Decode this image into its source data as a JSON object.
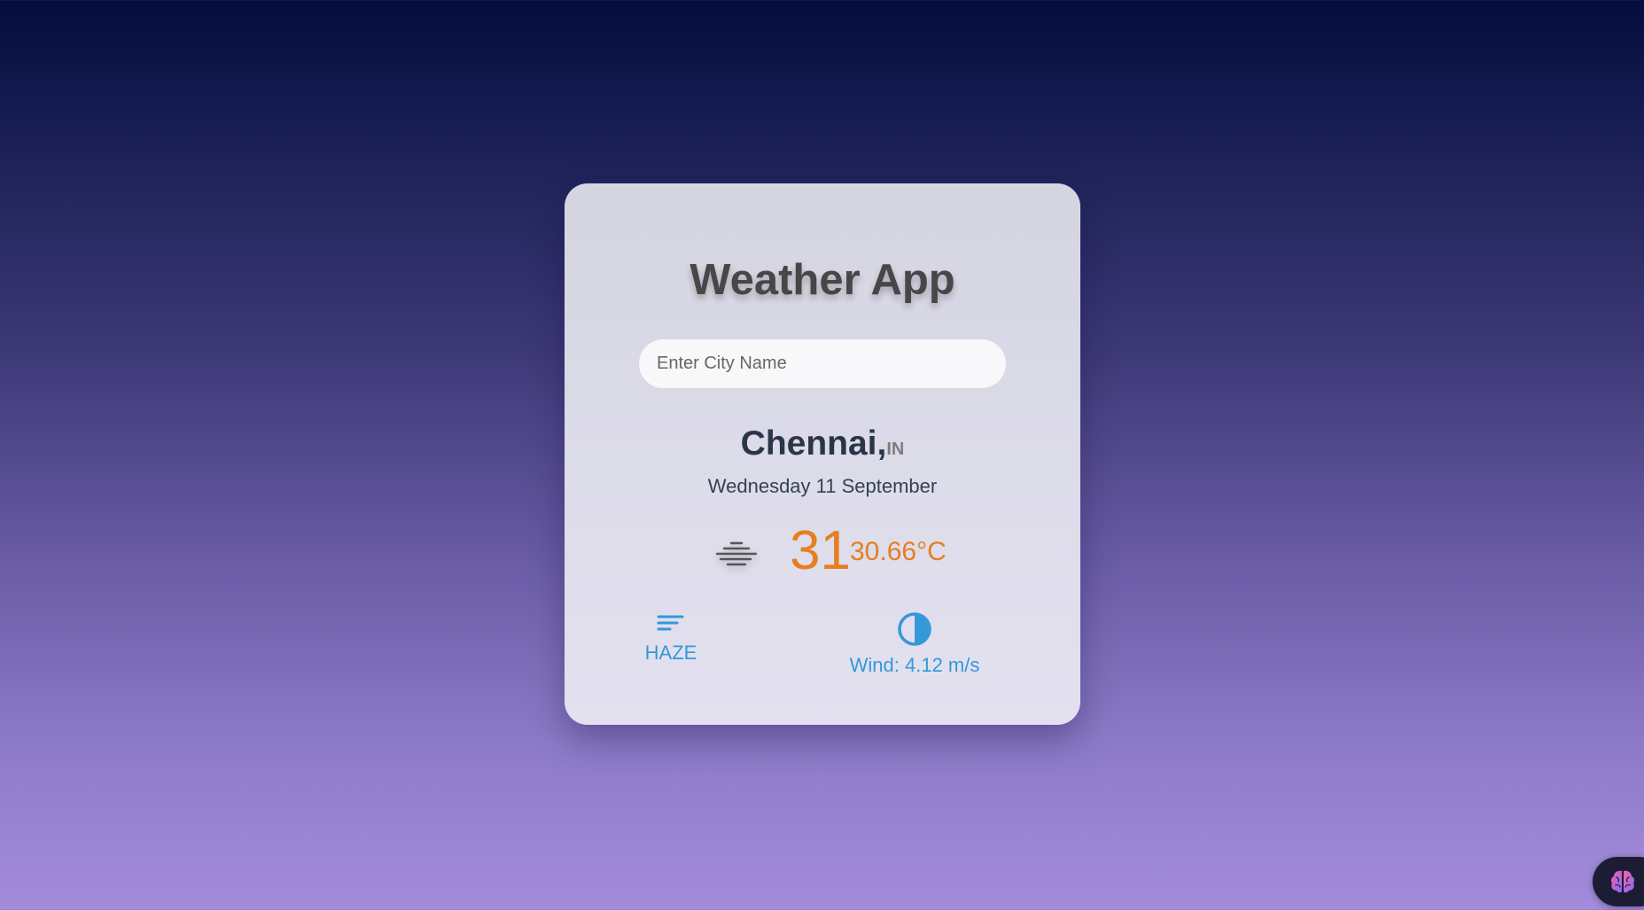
{
  "app": {
    "title": "Weather App"
  },
  "search": {
    "placeholder": "Enter City Name",
    "value": ""
  },
  "location": {
    "city": "Chennai,",
    "country": "IN",
    "date": "Wednesday 11 September"
  },
  "weather": {
    "icon": "haze-icon",
    "temperature_rounded": "31",
    "temperature_exact": "30.66°C",
    "condition": "HAZE",
    "condition_icon": "sort-lines-icon",
    "wind": "Wind: 4.12 m/s",
    "wind_icon": "half-circle-icon"
  },
  "assistant": {
    "icon": "brain-icon"
  },
  "colors": {
    "accent_orange": "#e67e22",
    "accent_blue": "#3498db",
    "title_text": "#474747",
    "city_text": "#2a3548"
  }
}
